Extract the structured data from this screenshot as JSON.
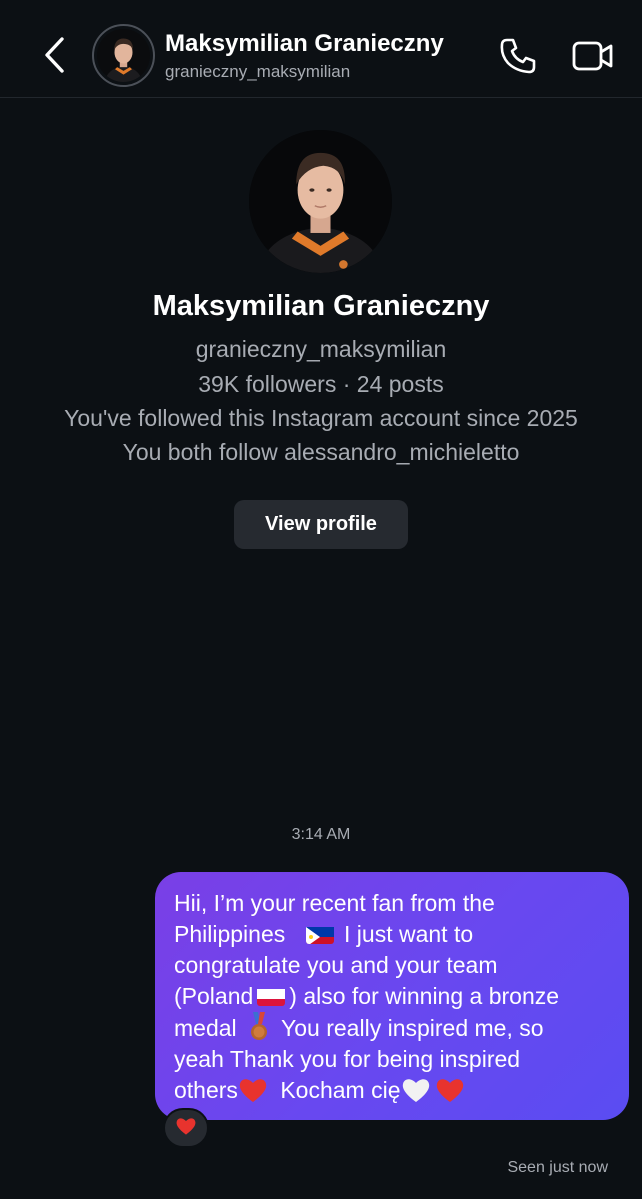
{
  "header": {
    "name": "Maksymilian Granieczny",
    "username": "granieczny_maksymilian"
  },
  "profile": {
    "name": "Maksymilian Granieczny",
    "username": "granieczny_maksymilian",
    "stats": "39K followers · 24 posts",
    "followed_since": "You've followed this Instagram account since 2025",
    "mutual": "You both follow alessandro_michieletto",
    "view_profile_label": "View profile"
  },
  "thread": {
    "timestamp": "3:14 AM",
    "message": {
      "line1": "Hii, I’m your recent fan from the",
      "line2_a": "Philippines",
      "line2_b": "I just want to",
      "line3": "congratulate you and your team",
      "line4_a": "(Poland",
      "line4_b": ")  also for winning a bronze",
      "line5_a": "medal",
      "line5_b": "You really inspired me, so",
      "line6": "yeah Thank you for being inspired",
      "line7_a": "others",
      "line7_b": "Kocham cię"
    },
    "reaction": "heart",
    "seen_status": "Seen just now"
  },
  "colors": {
    "background": "#0c1014",
    "bubble_start": "#7a3fe6",
    "bubble_end": "#5a4cf2",
    "secondary_text": "#a8acb3",
    "button_bg": "#262a30"
  },
  "icons": {
    "back": "chevron-left-icon",
    "call": "phone-icon",
    "video": "video-camera-icon"
  }
}
